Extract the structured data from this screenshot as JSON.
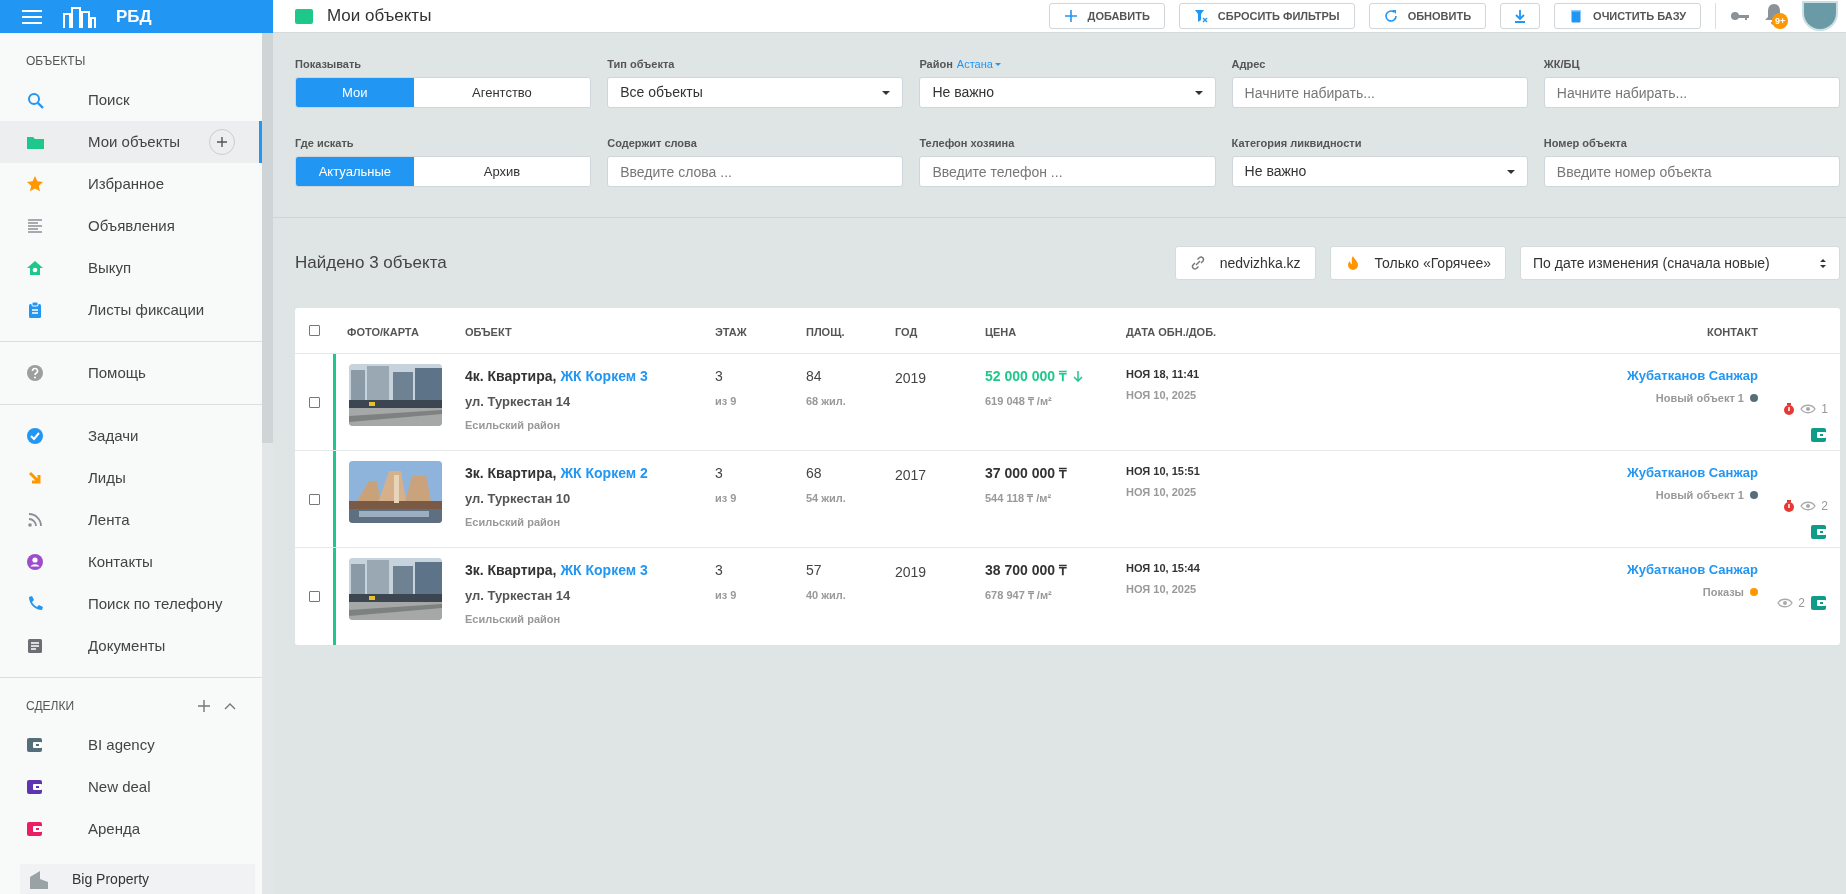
{
  "app": {
    "title": "РБД"
  },
  "header": {
    "title": "Мои объекты",
    "buttons": [
      {
        "label": "ДОБАВИТЬ"
      },
      {
        "label": "СБРОСИТЬ ФИЛЬТРЫ"
      },
      {
        "label": "ОБНОВИТЬ"
      },
      {
        "label": "ОЧИСТИТЬ БАЗУ"
      }
    ],
    "badge": "9+"
  },
  "sidebar": {
    "sections": [
      {
        "heading": "ОБЪЕКТЫ",
        "items": [
          {
            "label": "Поиск",
            "selected": false
          },
          {
            "label": "Мои объекты",
            "selected": true,
            "add_button": true
          },
          {
            "label": "Избранное",
            "selected": false
          },
          {
            "label": "Объявления",
            "selected": false
          },
          {
            "label": "Выкуп",
            "selected": false
          },
          {
            "label": "Листы фиксации",
            "selected": false
          }
        ]
      },
      {
        "items": [
          {
            "label": "Помощь",
            "selected": false
          }
        ]
      },
      {
        "items": [
          {
            "label": "Задачи",
            "selected": false
          },
          {
            "label": "Лиды",
            "selected": false
          },
          {
            "label": "Лента",
            "selected": false
          },
          {
            "label": "Контакты",
            "selected": false
          },
          {
            "label": "Поиск по телефону",
            "selected": false
          },
          {
            "label": "Документы",
            "selected": false
          }
        ]
      },
      {
        "heading": "СДЕЛКИ",
        "add_button": true,
        "expanded": true,
        "items": [
          {
            "label": "BI agency",
            "kind": "deal",
            "color": "#546e7a",
            "selected": false
          },
          {
            "label": "New deal",
            "kind": "deal",
            "color": "#5e35b1",
            "selected": false
          },
          {
            "label": "Аренда",
            "kind": "deal",
            "color": "#e91e63",
            "selected": false
          }
        ]
      }
    ],
    "footer": {
      "title": "Big Property"
    }
  },
  "filters": [
    {
      "kind": "toggle",
      "label": "Показывать",
      "options": [
        {
          "label": "Мои",
          "selected": true
        },
        {
          "label": "Агентство",
          "selected": false
        }
      ]
    },
    {
      "kind": "select",
      "label": "Тип объекта",
      "value": "Все объекты"
    },
    {
      "kind": "select",
      "label": "Район",
      "link": "Астана",
      "value": "Не важно"
    },
    {
      "kind": "input",
      "label": "Адрес",
      "placeholder": "Начните набирать..."
    },
    {
      "kind": "input",
      "label": "ЖК/БЦ",
      "placeholder": "Начните набирать..."
    },
    {
      "kind": "toggle",
      "label": "Где искать",
      "options": [
        {
          "label": "Актуальные",
          "selected": true
        },
        {
          "label": "Архив",
          "selected": false
        }
      ]
    },
    {
      "kind": "input",
      "label": "Содержит слова",
      "placeholder": "Введите слова ..."
    },
    {
      "kind": "input",
      "label": "Телефон хозяина",
      "placeholder": "Введите телефон ..."
    },
    {
      "kind": "select",
      "label": "Категория ликвидности",
      "value": "Не важно"
    },
    {
      "kind": "input",
      "label": "Номер объекта",
      "placeholder": "Введите номер объекта"
    }
  ],
  "results": {
    "count": "Найдено 3 объекта",
    "buttons": [
      {
        "label": "nedvizhka.kz"
      },
      {
        "label": "Только «Горячее»"
      }
    ],
    "sort": "По дате изменения (сначала новые)"
  },
  "table": {
    "all_checked": false,
    "columns": [
      "ФОТО/КАРТА",
      "ОБЪЕКТ",
      "ЭТАЖ",
      "ПЛОЩ.",
      "ГОД",
      "ЦЕНА",
      "ДАТА ОБН./ДОБ.",
      "КОНТАКТ"
    ],
    "rows": [
      {
        "checked": false,
        "highlighted": true,
        "type": "4к. Квартира,",
        "complex": "ЖК Коркем 3",
        "street": "ул. Туркестан 14",
        "district": "Есильский район",
        "floor": "3",
        "floors": "из 9",
        "area": "84",
        "living": "68 жил.",
        "year": "2019",
        "price": "52 000 000 ₸",
        "price_drop": true,
        "per_m2": "619 048 ₸ /м²",
        "updated": "НОЯ 18, 11:41",
        "added": "НОЯ 10, 2025",
        "contact": "Жубатканов Санжар",
        "status": "Новый объект 1",
        "color": "#546e7a",
        "hot": true,
        "views": "1"
      },
      {
        "checked": false,
        "highlighted": true,
        "type": "3к. Квартира,",
        "complex": "ЖК Коркем 2",
        "street": "ул. Туркестан 10",
        "district": "Есильский район",
        "floor": "3",
        "floors": "из 9",
        "area": "68",
        "living": "54 жил.",
        "year": "2017",
        "price": "37 000 000 ₸",
        "price_drop": false,
        "per_m2": "544 118 ₸ /м²",
        "updated": "НОЯ 10, 15:51",
        "added": "НОЯ 10, 2025",
        "contact": "Жубатканов Санжар",
        "status": "Новый объект 1",
        "color": "#546e7a",
        "hot": true,
        "views": "2"
      },
      {
        "checked": false,
        "highlighted": true,
        "type": "3к. Квартира,",
        "complex": "ЖК Коркем 3",
        "street": "ул. Туркестан 14",
        "district": "Есильский район",
        "floor": "3",
        "floors": "из 9",
        "area": "57",
        "living": "40 жил.",
        "year": "2019",
        "price": "38 700 000 ₸",
        "price_drop": false,
        "per_m2": "678 947 ₸ /м²",
        "updated": "НОЯ 10, 15:44",
        "added": "НОЯ 10, 2025",
        "contact": "Жубатканов Санжар",
        "status": "Показы",
        "color": "#ff9800",
        "hot": false,
        "views": "2"
      }
    ]
  }
}
